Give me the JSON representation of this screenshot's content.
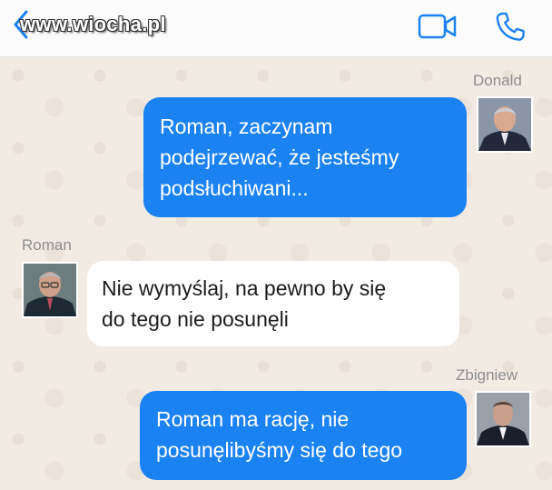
{
  "header": {
    "watermark": "www.wiocha.pl",
    "icons": {
      "back": "chevron-left-icon",
      "video": "video-camera-icon",
      "phone": "phone-icon"
    },
    "accent_color": "#1b82f2"
  },
  "messages": [
    {
      "sender": "Donald",
      "text_lines": [
        "Roman, zaczynam",
        "podejrzewać, że jesteśmy",
        "podsłuchiwani..."
      ],
      "direction": "outgoing"
    },
    {
      "sender": "Roman",
      "text_lines": [
        "Nie wymyślaj, na pewno by się",
        "do tego nie posunęli"
      ],
      "direction": "incoming"
    },
    {
      "sender": "Zbigniew",
      "text_lines": [
        "Roman ma rację, nie",
        "posunęlibyśmy się do tego"
      ],
      "direction": "outgoing"
    }
  ]
}
